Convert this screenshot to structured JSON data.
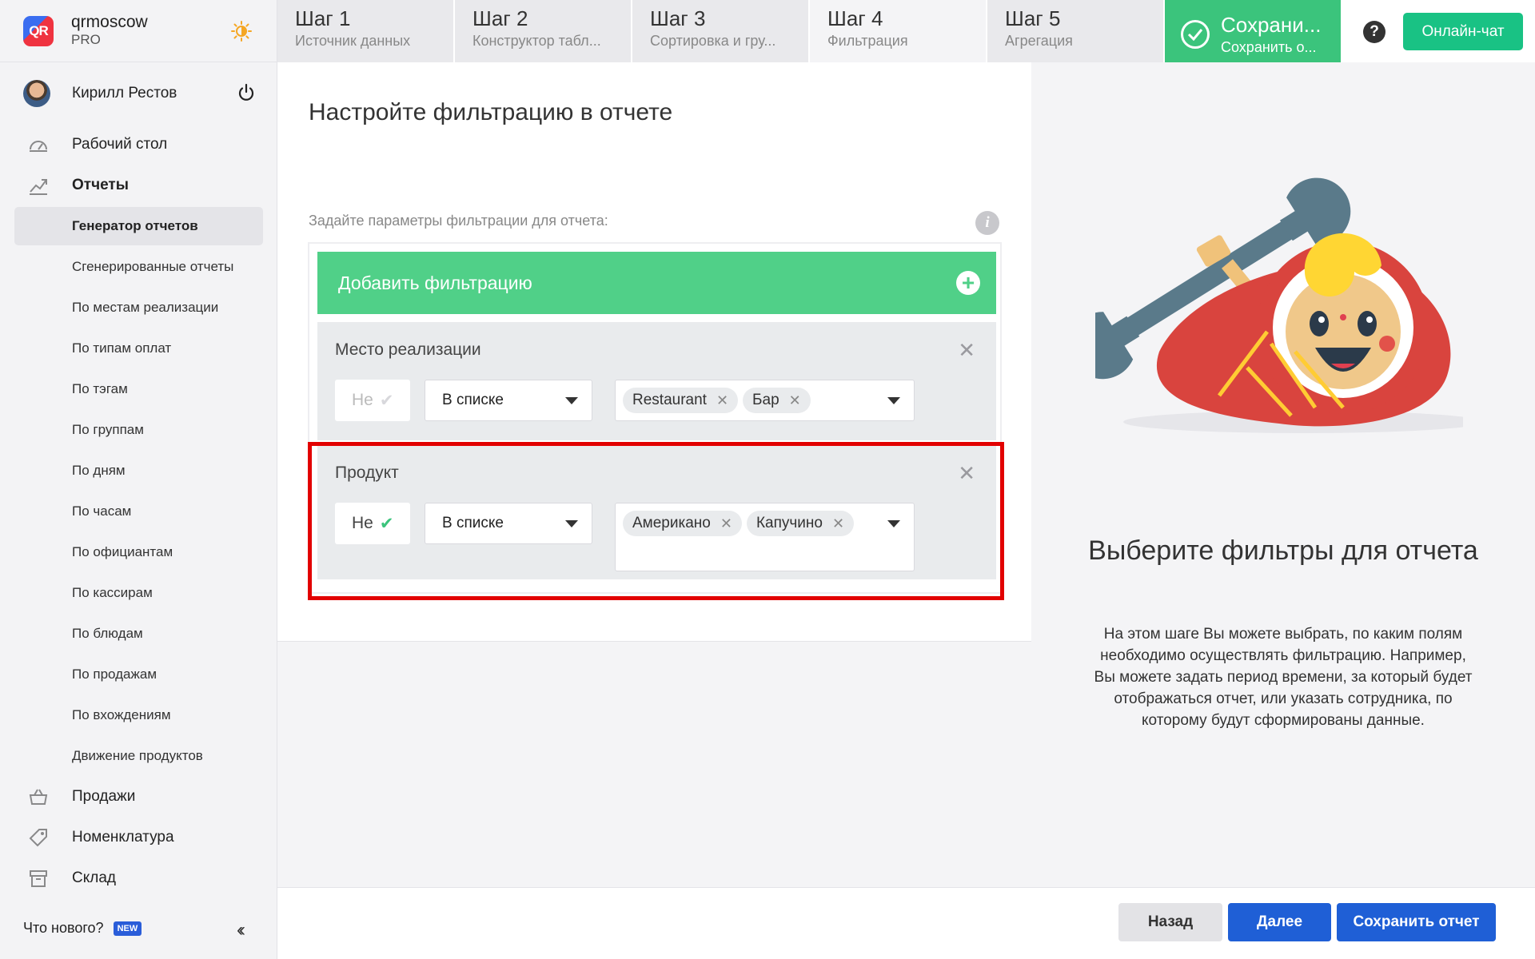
{
  "brand": {
    "name": "qrmoscow",
    "plan": "PRO",
    "logo_text": "QR"
  },
  "user": {
    "name": "Кирилл Рестов"
  },
  "nav": {
    "dashboard": "Рабочий стол",
    "reports": "Отчеты",
    "sub": [
      "Генератор отчетов",
      "Сгенерированные отчеты",
      "По местам реализации",
      "По типам оплат",
      "По тэгам",
      "По группам",
      "По дням",
      "По часам",
      "По официантам",
      "По кассирам",
      "По блюдам",
      "По продажам",
      "По вхождениям",
      "Движение продуктов"
    ],
    "sales": "Продажи",
    "nomenclature": "Номенклатура",
    "warehouse": "Склад"
  },
  "whats_new": {
    "label": "Что нового?",
    "badge": "NEW"
  },
  "steps": [
    {
      "num": "Шаг 1",
      "label": "Источник данных"
    },
    {
      "num": "Шаг 2",
      "label": "Конструктор табл..."
    },
    {
      "num": "Шаг 3",
      "label": "Сортировка и гру..."
    },
    {
      "num": "Шаг 4",
      "label": "Фильтрация"
    },
    {
      "num": "Шаг 5",
      "label": "Агрегация"
    }
  ],
  "save_step": {
    "title": "Сохрани...",
    "subtitle": "Сохранить о..."
  },
  "help_glyph": "?",
  "chat_label": "Онлайн-чат",
  "main": {
    "title": "Настройте фильтрацию в отчете",
    "hint": "Задайте параметры фильтрации для отчета:",
    "info_glyph": "i",
    "add_label": "Добавить фильтрацию",
    "filters": [
      {
        "name": "Место реализации",
        "negate_label": "Не",
        "negate_checked": false,
        "operator": "В списке",
        "values": [
          "Restaurant",
          "Бар"
        ]
      },
      {
        "name": "Продукт",
        "negate_label": "Не",
        "negate_checked": true,
        "operator": "В списке",
        "values": [
          "Американо",
          "Капучино"
        ]
      }
    ]
  },
  "aside": {
    "title": "Выберите фильтры для отчета",
    "text": "На этом шаге Вы можете выбрать, по каким полям необходимо осуществлять фильтрацию. Например, Вы можете задать период времени, за который будет отображаться отчет, или указать сотрудника, по которому будут сформированы данные."
  },
  "footer": {
    "back": "Назад",
    "next": "Далее",
    "save": "Сохранить отчет"
  },
  "colors": {
    "green": "#3bc47c",
    "blue": "#1f5fd6",
    "highlight": "#e20000"
  },
  "icons": [
    "sun-icon",
    "power-icon",
    "dashboard-icon",
    "reports-icon",
    "sales-icon",
    "nomenclature-icon",
    "warehouse-icon",
    "check-circle-icon",
    "help-icon",
    "info-icon",
    "plus-icon",
    "close-icon",
    "check-icon",
    "chevron-down-icon",
    "double-chevron-left-icon"
  ]
}
